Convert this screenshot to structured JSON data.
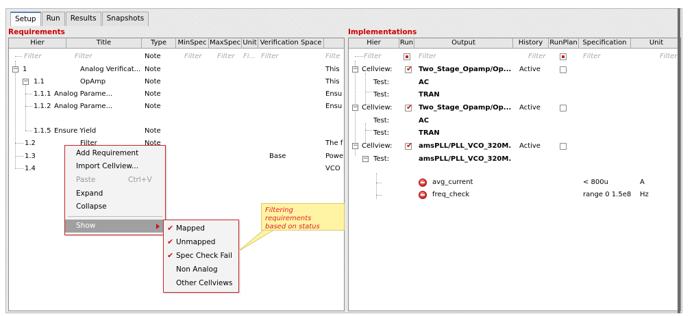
{
  "tabs": [
    "Setup",
    "Run",
    "Results",
    "Snapshots"
  ],
  "requirements": {
    "title": "Requirements",
    "columns": [
      "Hier",
      "Title",
      "Type",
      "MinSpec",
      "MaxSpec",
      "Unit",
      "Verification Space",
      ""
    ],
    "filter_row": {
      "hier": "Filter",
      "title": "Filter",
      "type": "Note",
      "minspec": "Filter",
      "maxspec": "Filter",
      "unit": "Fi...",
      "vspace": "Filter",
      "desc": "Filte"
    },
    "rows": [
      {
        "hier": "1",
        "title": "Analog Verificat...",
        "type": "Note",
        "vspace": "",
        "desc": "This"
      },
      {
        "hier": "1.1",
        "title": "OpAmp",
        "type": "Note",
        "vspace": "",
        "desc": "This"
      },
      {
        "hier": "1.1.1",
        "title": "Analog Parame...",
        "type": "Note",
        "vspace": "",
        "desc": "Ensu"
      },
      {
        "hier": "1.1.2",
        "title": "Analog Parame...",
        "type": "Note",
        "vspace": "",
        "desc": "Ensu"
      },
      {
        "hier": "1.1.5",
        "title": "Ensure Yield",
        "type": "Note",
        "vspace": "",
        "desc": ""
      },
      {
        "hier": "1.2",
        "title": "Filter",
        "type": "Note",
        "vspace": "",
        "desc": "The f"
      },
      {
        "hier": "1.3",
        "title": "",
        "type": "",
        "vspace": "Base",
        "desc": "Powe"
      },
      {
        "hier": "1.4",
        "title": "",
        "type": "",
        "vspace": "",
        "desc": "VCO"
      }
    ]
  },
  "implementations": {
    "title": "Implementations",
    "columns": [
      "Hier",
      "Run",
      "Output",
      "History",
      "RunPlan",
      "Specification",
      "Unit"
    ],
    "filter_row": {
      "hier": "Filter",
      "output": "Filter",
      "history": "Filter",
      "spec": "Filter",
      "unit": "Filter"
    },
    "rows": [
      {
        "hier": "Cellview:",
        "output": "Two_Stage_Opamp/Op...",
        "history": "Active",
        "spec": "",
        "unit": ""
      },
      {
        "hier": "Test:",
        "output": "AC",
        "history": "",
        "spec": "",
        "unit": ""
      },
      {
        "hier": "Test:",
        "output": "TRAN",
        "history": "",
        "spec": "",
        "unit": ""
      },
      {
        "hier": "Cellview:",
        "output": "Two_Stage_Opamp/Op...",
        "history": "Active",
        "spec": "",
        "unit": ""
      },
      {
        "hier": "Test:",
        "output": "AC",
        "history": "",
        "spec": "",
        "unit": ""
      },
      {
        "hier": "Test:",
        "output": "TRAN",
        "history": "",
        "spec": "",
        "unit": ""
      },
      {
        "hier": "Cellview:",
        "output": "amsPLL/PLL_VCO_320M...",
        "history": "Active",
        "spec": "",
        "unit": ""
      },
      {
        "hier": "Test:",
        "output": "amsPLL/PLL_VCO_320M...",
        "history": "",
        "spec": "",
        "unit": ""
      },
      {
        "hier": "",
        "output": "avg_current",
        "history": "",
        "spec": "< 800u",
        "unit": "A"
      },
      {
        "hier": "",
        "output": "freq_check",
        "history": "",
        "spec": "range 0 1.5e8",
        "unit": "Hz"
      }
    ]
  },
  "context_menu": {
    "items": [
      {
        "label": "Add Requirement",
        "shortcut": ""
      },
      {
        "label": "Import Cellview...",
        "shortcut": ""
      },
      {
        "label": "Paste",
        "shortcut": "Ctrl+V"
      },
      {
        "label": "Expand",
        "shortcut": ""
      },
      {
        "label": "Collapse",
        "shortcut": ""
      },
      {
        "label": "Show",
        "shortcut": ""
      }
    ]
  },
  "show_submenu": {
    "items": [
      {
        "label": "Mapped",
        "checked": true
      },
      {
        "label": "Unmapped",
        "checked": true
      },
      {
        "label": "Spec Check Fail",
        "checked": true
      },
      {
        "label": "Non Analog",
        "checked": false
      },
      {
        "label": "Other Cellviews",
        "checked": false
      }
    ]
  },
  "callout": {
    "line1": "Filtering requirements",
    "line2": "based on status"
  },
  "colors": {
    "accent_red": "#cc0000",
    "callout_bg": "#fff4a4",
    "menu_highlight": "#a0a0a0"
  }
}
